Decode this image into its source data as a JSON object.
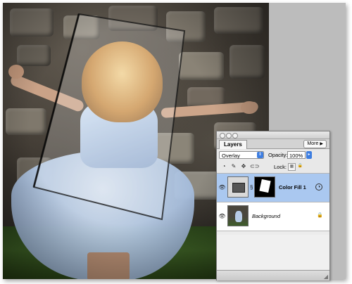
{
  "canvas": {
    "image_subject": "girl-twirling-photo"
  },
  "layers_panel": {
    "tab_label": "Layers",
    "more_label": "More",
    "blend_mode": "Overlay",
    "opacity_label": "Opacity:",
    "opacity_value": "100%",
    "lock_label": "Lock:",
    "layers": [
      {
        "name": "Color Fill 1",
        "selected": true
      },
      {
        "name": "Background",
        "selected": false
      }
    ]
  },
  "colors": {
    "selection": "#aac8f0",
    "accent": "#3d7de0",
    "panel": "#ececec"
  },
  "icons": [
    "eye-icon",
    "link-icon",
    "fx-icon",
    "lock-icon",
    "close-icon",
    "minimize-icon",
    "zoom-icon",
    "resize-grip-icon"
  ]
}
